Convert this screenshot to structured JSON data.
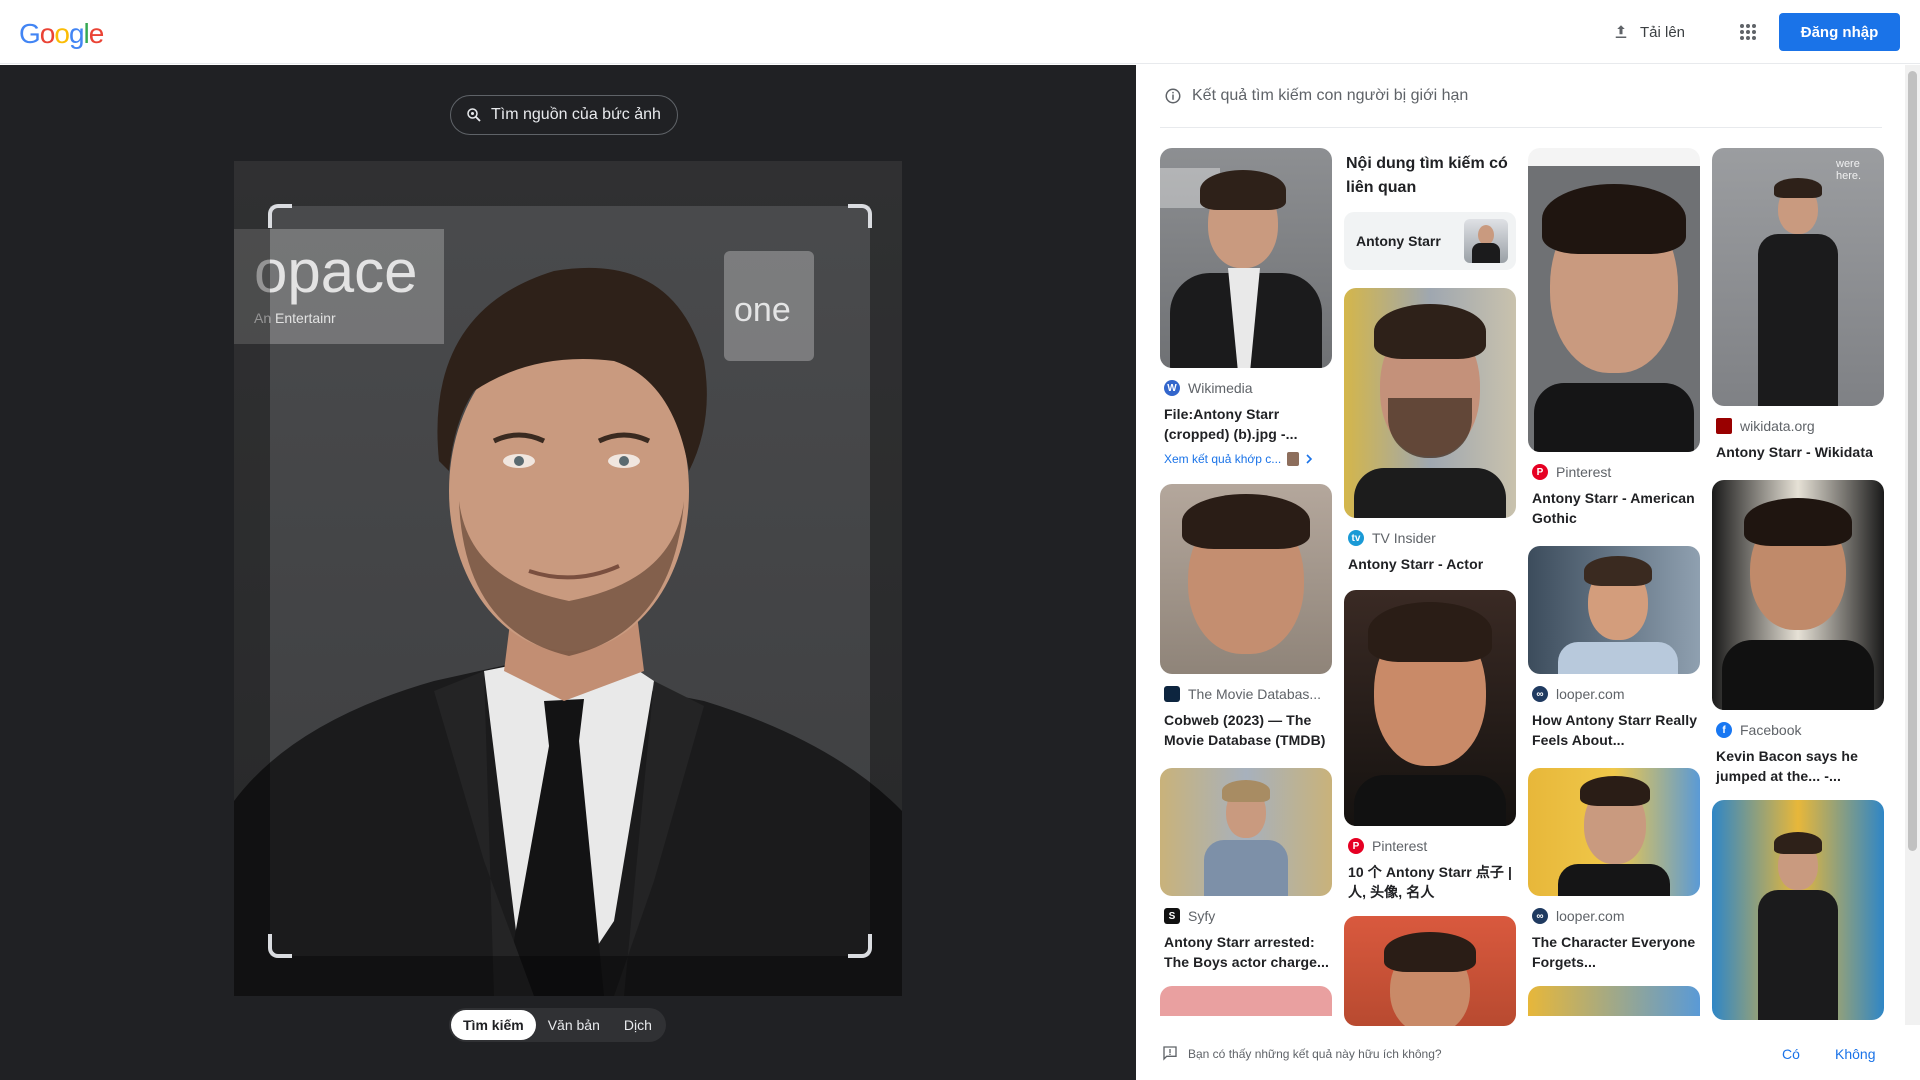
{
  "header": {
    "logo_letters": [
      "G",
      "o",
      "o",
      "g",
      "l",
      "e"
    ],
    "logo_colors": [
      "#4285f4",
      "#ea4335",
      "#fbbc05",
      "#4285f4",
      "#34a853",
      "#ea4335"
    ],
    "upload_label": "Tải lên",
    "login_label": "Đăng nhập"
  },
  "lens": {
    "find_source_label": "Tìm nguồn của bức ảnh",
    "photo_sign_text": "opace",
    "photo_sign_sub": "An Entertainr",
    "photo_sign2_text": "one",
    "modes": [
      "Tìm kiếm",
      "Văn bản",
      "Dịch"
    ],
    "active_mode": "Tìm kiếm"
  },
  "results": {
    "limited_notice": "Kết quả tìm kiếm con người bị giới hạn",
    "related_title": "Nội dung tìm kiếm có liên quan",
    "related_chip": "Antony Starr",
    "more_matches": "Xem kết quả khớp c...",
    "col1": [
      {
        "source": "Wikimedia",
        "title": "File:Antony Starr (cropped) (b).jpg -...",
        "icon_color": "#3366cc"
      },
      {
        "source": "The Movie Databas...",
        "title": "Cobweb (2023) — The Movie Database (TMDB)",
        "icon_color": "#0d253f"
      },
      {
        "source": "Syfy",
        "title": "Antony Starr arrested: The Boys actor charge...",
        "icon_color": "#111111"
      }
    ],
    "col2": [
      {
        "source": "TV Insider",
        "title": "Antony Starr - Actor",
        "icon_color": "#1a9ad6"
      },
      {
        "source": "Pinterest",
        "title": "10 个 Antony Starr 点子 | 人, 头像, 名人",
        "icon_color": "#e60023"
      }
    ],
    "col3": [
      {
        "source": "Pinterest",
        "title": "Antony Starr - American Gothic",
        "icon_color": "#e60023"
      },
      {
        "source": "looper.com",
        "title": "How Antony Starr Really Feels About...",
        "icon_color": "#1f3a60"
      },
      {
        "source": "looper.com",
        "title": "The Character Everyone Forgets...",
        "icon_color": "#1f3a60"
      }
    ],
    "col4": [
      {
        "source": "wikidata.org",
        "title": "Antony Starr - Wikidata",
        "icon_color": "#990000"
      },
      {
        "source": "Facebook",
        "title": "Kevin Bacon says he jumped at the... -...",
        "icon_color": "#1877f2"
      }
    ]
  },
  "feedback": {
    "question": "Bạn có thấy những kết quả này hữu ích không?",
    "yes": "Có",
    "no": "Không"
  }
}
